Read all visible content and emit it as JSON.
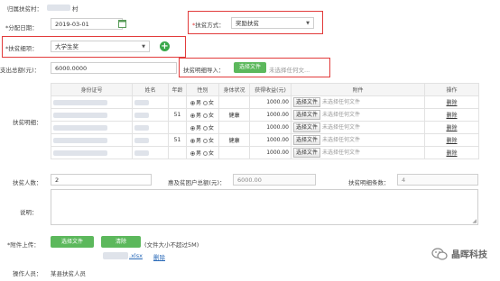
{
  "header": {
    "village_label": "归属扶贫村：",
    "village_value_suffix": "村",
    "distribution_date_label": "*分配日期：",
    "distribution_date": "2019-03-01",
    "method_label": "扶贫方式：",
    "method_value": "奖励扶贫",
    "item_label": "*扶贫细项：",
    "item_value": "大学生奖",
    "total_label": "支出总额(元)：",
    "total_value": "6000.0000",
    "import_label": "扶贫明细导入：",
    "import_button": "选择文件",
    "import_status": "未选择任何文..."
  },
  "detail_table": {
    "section_label": "扶贫明细：",
    "columns": [
      "身份证号",
      "姓名",
      "年龄",
      "性别",
      "身体状况",
      "获得收益(元)",
      "附件",
      "操作"
    ],
    "gender_male": "男",
    "gender_female": "女",
    "file_button": "选择文件",
    "file_status": "未选择任何文件",
    "delete_label": "删除",
    "rows": [
      {
        "age": "",
        "health": "",
        "income": "1000.00"
      },
      {
        "age": "51",
        "health": "健康",
        "income": "1000.00"
      },
      {
        "age": "",
        "health": "",
        "income": "1000.00"
      },
      {
        "age": "51",
        "health": "健康",
        "income": "1000.00"
      },
      {
        "age": "",
        "health": "",
        "income": "1000.00"
      }
    ]
  },
  "summary": {
    "count_label": "扶贫人数：",
    "count_value": "2",
    "household_total_label": "惠及贫困户总额(元)：",
    "household_total_value": "6000.00",
    "detail_count_label": "扶贫明细条数：",
    "detail_count_value": "4"
  },
  "notes": {
    "label": "说明："
  },
  "attachment": {
    "label": "*附件上传：",
    "select_button": "选择文件",
    "clear_button": "清除",
    "size_note": "(文件大小不超过5M)",
    "file_name_suffix": ".xlsx",
    "delete_link": "删除"
  },
  "operator": {
    "label": "操作人员：",
    "value": "某县扶贫人员"
  },
  "watermark": {
    "text": "晶晖科技"
  },
  "colors": {
    "highlight_border": "#e23b3b",
    "green_button": "#5cb85c",
    "link": "#2a6ab8"
  }
}
